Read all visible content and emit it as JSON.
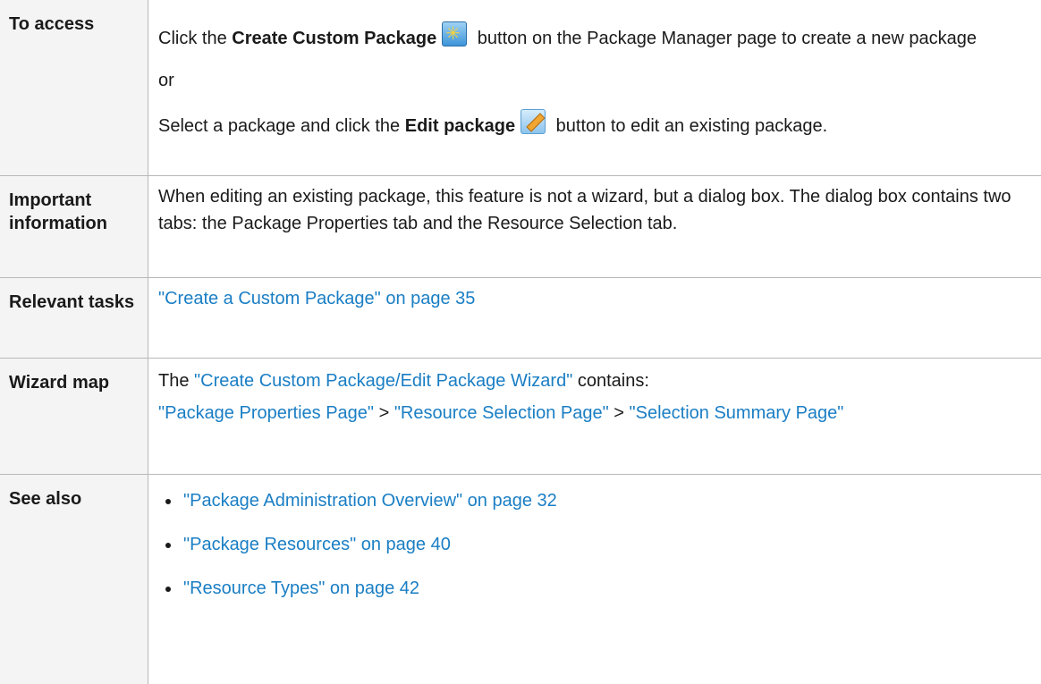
{
  "rows": {
    "access": {
      "label": "To access",
      "line1_pre": "Click the ",
      "line1_bold": "Create Custom Package",
      "line1_post": " button on the Package Manager page to create a new package",
      "or": "or",
      "line2_pre": "Select a package and click the ",
      "line2_bold": "Edit package",
      "line2_post": " button to edit an existing package."
    },
    "important": {
      "label": "Important information",
      "text": "When editing an existing package, this feature is not a wizard, but a dialog box. The dialog box contains two tabs: the Package Properties tab and the Resource Selection tab."
    },
    "tasks": {
      "label": "Relevant tasks",
      "link": "\"Create a Custom Package\" on page 35"
    },
    "wizard": {
      "label": "Wizard map",
      "pre": "The ",
      "link": "\"Create Custom Package/Edit Package Wizard\"",
      "post": " contains:",
      "map": [
        "\"Package Properties Page\"",
        "\"Resource Selection Page\"",
        "\"Selection Summary Page\""
      ],
      "sep": " > "
    },
    "see_also": {
      "label": "See also",
      "links": [
        "\"Package Administration Overview\" on page 32",
        "\"Package Resources\" on page 40",
        "\"Resource Types\" on page 42"
      ]
    }
  },
  "icons": {
    "create_custom_package": "star-icon",
    "edit_package": "pencil-icon"
  },
  "colors": {
    "link": "#1a7ec4",
    "label_bg": "#f4f4f4",
    "border": "#b8b8b8"
  }
}
